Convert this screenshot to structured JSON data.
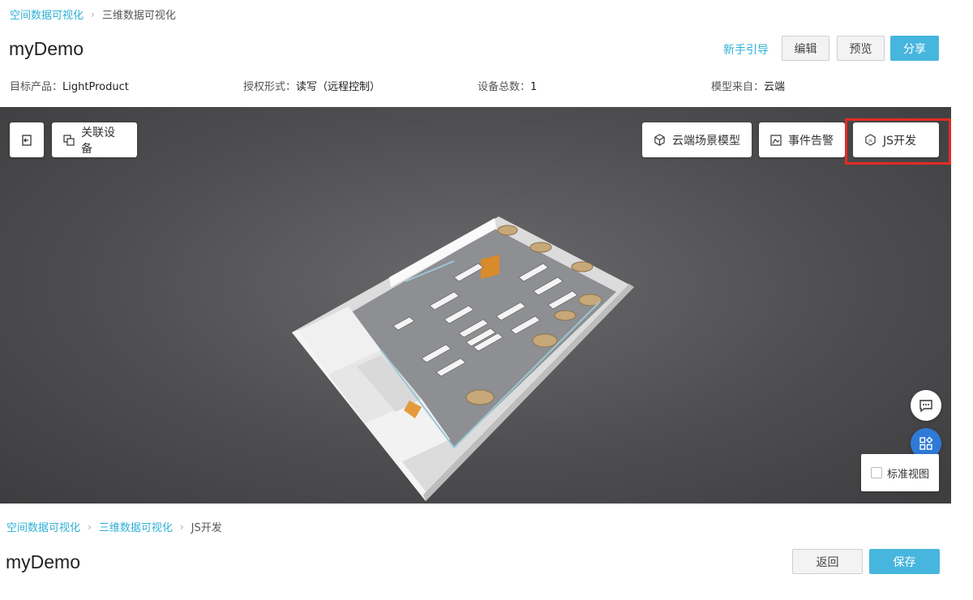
{
  "top": {
    "breadcrumb": [
      "空间数据可视化",
      "三维数据可视化"
    ],
    "title": "myDemo",
    "guide_link": "新手引导",
    "edit_label": "编辑",
    "preview_label": "预览",
    "share_label": "分享",
    "meta": [
      {
        "label": "目标产品：",
        "value": "LightProduct"
      },
      {
        "label": "授权形式：",
        "value": "读写（远程控制）"
      },
      {
        "label": "设备总数：",
        "value": "1"
      },
      {
        "label": "模型来自：",
        "value": "云端"
      }
    ]
  },
  "viewport": {
    "toolbar": {
      "back_icon": "exit-icon",
      "link_devices_label": "关联设备",
      "cloud_model_label": "云端场景模型",
      "event_alert_label": "事件告警",
      "js_dev_label": "JS开发"
    },
    "chat_icon": "chat-icon",
    "apps_icon": "apps-icon",
    "standard_view_label": "标准视图",
    "accent": "#2f7ad6"
  },
  "bottom": {
    "breadcrumb": [
      "空间数据可视化",
      "三维数据可视化",
      "JS开发"
    ],
    "title": "myDemo",
    "back_label": "返回",
    "save_label": "保存"
  },
  "colors": {
    "link": "#2fb0d6",
    "primary": "#47b6de",
    "highlight": "#e22b24"
  }
}
